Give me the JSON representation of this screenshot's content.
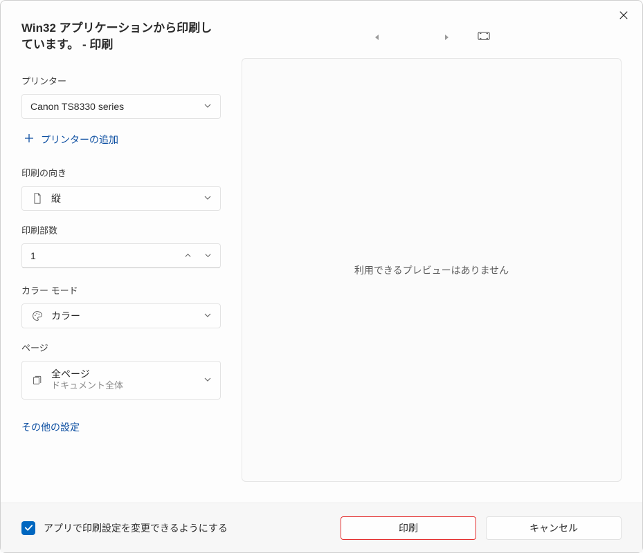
{
  "dialog": {
    "title": "Win32 アプリケーションから印刷しています。 - 印刷"
  },
  "printer": {
    "label": "プリンター",
    "selected": "Canon TS8330 series",
    "add_label": "プリンターの追加"
  },
  "orientation": {
    "label": "印刷の向き",
    "selected": "縦"
  },
  "copies": {
    "label": "印刷部数",
    "value": "1"
  },
  "color_mode": {
    "label": "カラー モード",
    "selected": "カラー"
  },
  "pages": {
    "label": "ページ",
    "selected": "全ページ",
    "sub": "ドキュメント全体"
  },
  "more_settings": "その他の設定",
  "preview": {
    "no_preview": "利用できるプレビューはありません"
  },
  "footer": {
    "checkbox_label": "アプリで印刷設定を変更できるようにする",
    "checkbox_checked": true,
    "print_label": "印刷",
    "cancel_label": "キャンセル"
  },
  "colors": {
    "accent": "#0067c0",
    "link": "#0c4ea1",
    "highlight_border": "#e42f2f"
  }
}
